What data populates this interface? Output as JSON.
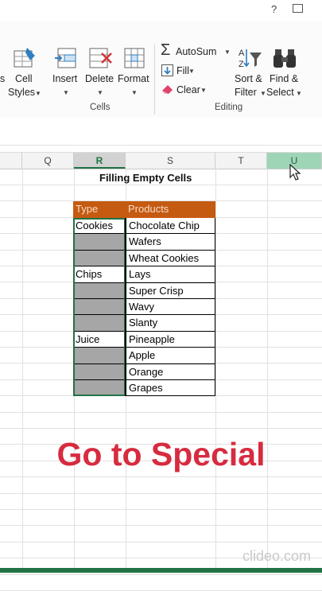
{
  "titlebar": {
    "help": "?",
    "restore_icon": "ribbon-display-icon"
  },
  "ribbon": {
    "cells_group": {
      "partial_label": "s",
      "cell_styles_line1": "Cell",
      "cell_styles_line2": "Styles",
      "insert": "Insert",
      "delete": "Delete",
      "format": "Format",
      "group_label": "Cells"
    },
    "editing_group": {
      "autosum": "AutoSum",
      "fill": "Fill",
      "clear": "Clear",
      "sort_line1": "Sort &",
      "sort_line2": "Filter",
      "find_line1": "Find &",
      "find_line2": "Select",
      "group_label": "Editing"
    }
  },
  "columns": [
    "Q",
    "R",
    "S",
    "T",
    "U"
  ],
  "selected_column": "R",
  "active_header": "U",
  "sheet": {
    "title": "Filling Empty Cells",
    "headers": {
      "type": "Type",
      "products": "Products"
    },
    "rows": [
      {
        "type": "Cookies",
        "product": "Chocolate Chip"
      },
      {
        "type": "",
        "product": "Wafers"
      },
      {
        "type": "",
        "product": "Wheat Cookies"
      },
      {
        "type": "Chips",
        "product": "Lays"
      },
      {
        "type": "",
        "product": "Super Crisp"
      },
      {
        "type": "",
        "product": "Wavy"
      },
      {
        "type": "",
        "product": "Slanty"
      },
      {
        "type": "Juice",
        "product": "Pineapple"
      },
      {
        "type": "",
        "product": "Apple"
      },
      {
        "type": "",
        "product": "Orange"
      },
      {
        "type": "",
        "product": "Grapes"
      }
    ]
  },
  "overlay_text": "Go to Special",
  "watermark": "clideo.com",
  "colors": {
    "header_fill": "#c55a11",
    "header_text": "#f7dcc8",
    "selection_fill": "#a6a6a6",
    "selection_border": "#217346",
    "overlay_text": "#d72b3f",
    "active_header": "#9fd5b7"
  }
}
